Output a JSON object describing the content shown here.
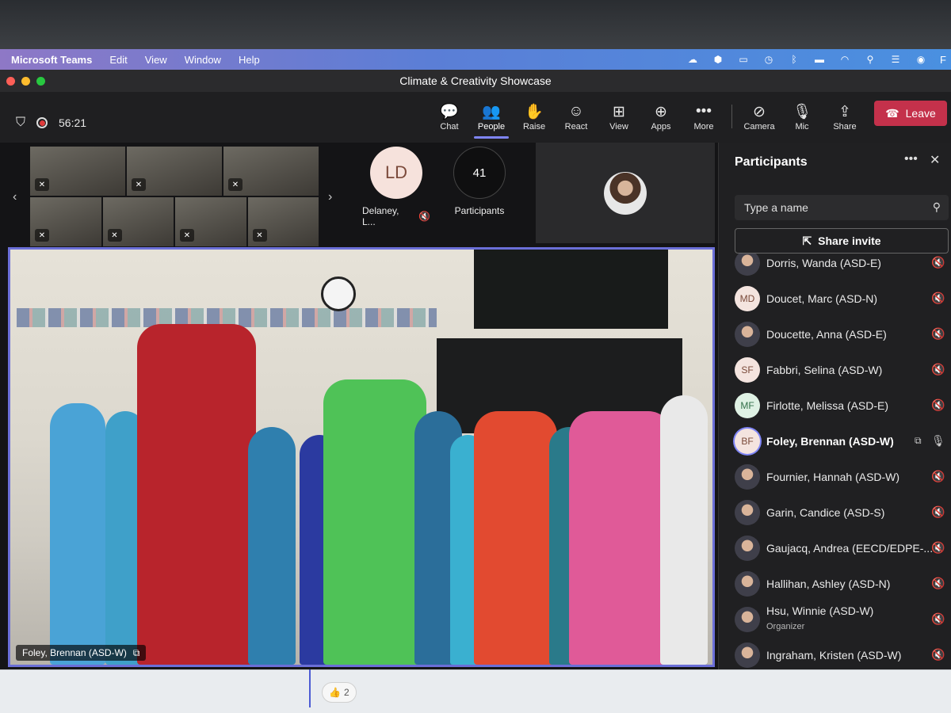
{
  "menubar": {
    "app_name": "Microsoft Teams",
    "items": [
      "Edit",
      "View",
      "Window",
      "Help"
    ],
    "right_icons": [
      "creative-cloud-icon",
      "vpn-icon",
      "display-icon",
      "time-machine-icon",
      "bluetooth-icon",
      "battery-icon",
      "wifi-icon",
      "search-icon",
      "control-center-icon",
      "siri-icon"
    ],
    "right_text": "F"
  },
  "window": {
    "title": "Climate & Creativity Showcase"
  },
  "toolbar": {
    "timer": "56:21",
    "buttons": [
      {
        "label": "Chat",
        "icon": "chat-icon"
      },
      {
        "label": "People",
        "icon": "people-icon"
      },
      {
        "label": "Raise",
        "icon": "raise-hand-icon"
      },
      {
        "label": "React",
        "icon": "react-icon"
      },
      {
        "label": "View",
        "icon": "view-icon"
      },
      {
        "label": "Apps",
        "icon": "apps-icon"
      },
      {
        "label": "More",
        "icon": "more-icon"
      },
      {
        "label": "Camera",
        "icon": "camera-off-icon"
      },
      {
        "label": "Mic",
        "icon": "mic-off-icon"
      },
      {
        "label": "Share",
        "icon": "share-icon"
      }
    ],
    "leave_label": "Leave"
  },
  "stage": {
    "tile_ld": {
      "initials": "LD",
      "label": "Delaney, L..."
    },
    "tile_count": {
      "count": "41",
      "label": "Participants"
    },
    "main_caption": "Foley, Brennan (ASD-W)"
  },
  "panel": {
    "title": "Participants",
    "search_placeholder": "Type a name",
    "share_invite": "Share invite",
    "participants": [
      {
        "name": "Dorris, Wanda (ASD-E)",
        "avatar": "photo",
        "initials": ""
      },
      {
        "name": "Doucet, Marc (ASD-N)",
        "avatar": "initials",
        "initials": "MD"
      },
      {
        "name": "Doucette, Anna (ASD-E)",
        "avatar": "photo",
        "initials": ""
      },
      {
        "name": "Fabbri, Selina (ASD-W)",
        "avatar": "initials",
        "initials": "SF"
      },
      {
        "name": "Firlotte, Melissa (ASD-E)",
        "avatar": "initials-green",
        "initials": "MF"
      },
      {
        "name": "Foley, Brennan (ASD-W)",
        "avatar": "initials-selected",
        "initials": "BF"
      },
      {
        "name": "Fournier, Hannah (ASD-W)",
        "avatar": "photo",
        "initials": ""
      },
      {
        "name": "Garin, Candice (ASD-S)",
        "avatar": "photo",
        "initials": ""
      },
      {
        "name": "Gaujacq, Andrea (EECD/EDPE-...",
        "avatar": "photo",
        "initials": ""
      },
      {
        "name": "Hallihan, Ashley (ASD-N)",
        "avatar": "photo",
        "initials": ""
      },
      {
        "name": "Hsu, Winnie (ASD-W)",
        "avatar": "photo",
        "initials": "",
        "role": "Organizer"
      },
      {
        "name": "Ingraham, Kristen (ASD-W)",
        "avatar": "photo",
        "initials": ""
      }
    ]
  },
  "reaction": {
    "icon": "thumbs-up-icon",
    "count": "2"
  },
  "colors": {
    "accent": "#7f85f5",
    "leave": "#c4314b",
    "panel_bg": "#202022"
  }
}
